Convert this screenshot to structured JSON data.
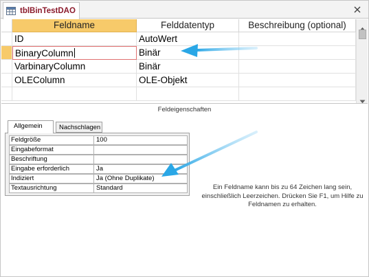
{
  "tab": {
    "title": "tblBinTestDAO",
    "icon": "table-icon",
    "close_icon": "close-icon"
  },
  "grid": {
    "headers": {
      "fieldname": "Feldname",
      "datatype": "Felddatentyp",
      "description": "Beschreibung (optional)"
    },
    "rows": [
      {
        "fieldname": "ID",
        "datatype": "AutoWert",
        "description": ""
      },
      {
        "fieldname": "BinaryColumn",
        "datatype": "Binär",
        "description": ""
      },
      {
        "fieldname": "VarbinaryColumn",
        "datatype": "Binär",
        "description": ""
      },
      {
        "fieldname": "OLEColumn",
        "datatype": "OLE-Objekt",
        "description": ""
      },
      {
        "fieldname": "",
        "datatype": "",
        "description": ""
      }
    ],
    "current_row": 1
  },
  "properties": {
    "title": "Feldeigenschaften",
    "tabs": [
      "Allgemein",
      "Nachschlagen"
    ],
    "active_tab": "Allgemein",
    "rows": [
      {
        "label": "Feldgröße",
        "value": "100"
      },
      {
        "label": "Eingabeformat",
        "value": ""
      },
      {
        "label": "Beschriftung",
        "value": ""
      },
      {
        "label": "Eingabe erforderlich",
        "value": "Ja"
      },
      {
        "label": "Indiziert",
        "value": "Ja (Ohne Duplikate)"
      },
      {
        "label": "Textausrichtung",
        "value": "Standard"
      }
    ],
    "help_text": "Ein Feldname kann bis zu 64 Zeichen lang sein, einschließlich Leerzeichen. Drücken Sie F1, um Hilfe zu Feldnamen zu erhalten."
  },
  "colors": {
    "accent_header": "#f7ca6a",
    "tab_title": "#8b1a2b",
    "annotation_arrow": "#2aa7e6"
  }
}
